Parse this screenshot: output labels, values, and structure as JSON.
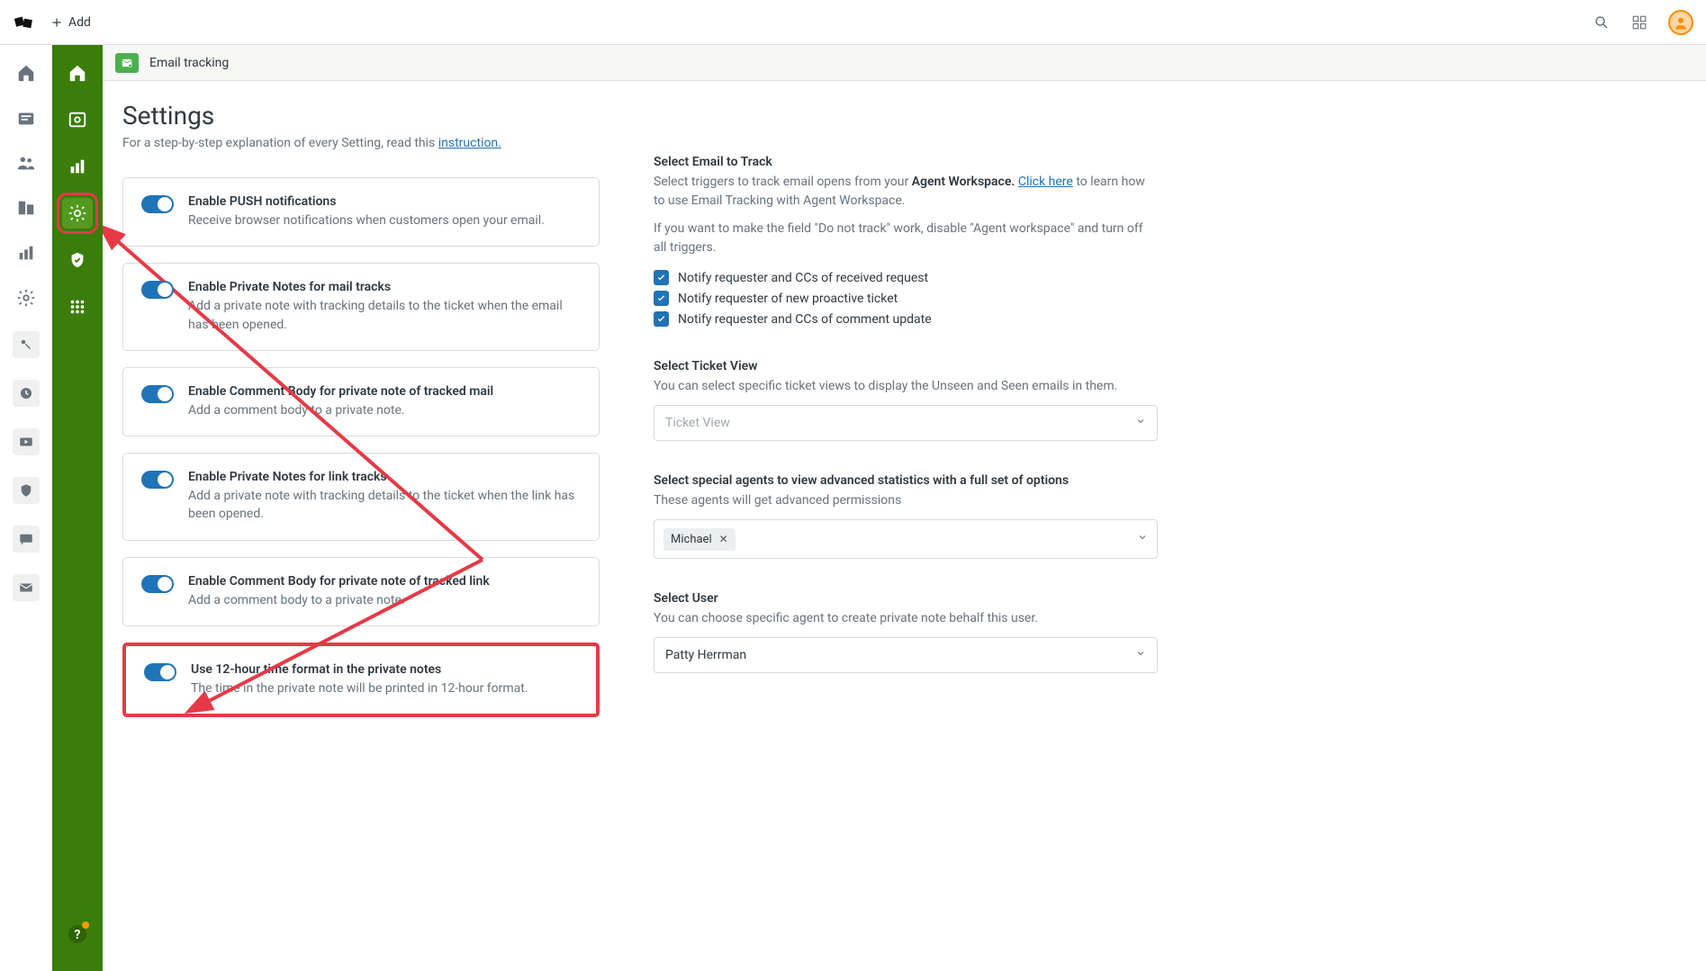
{
  "topbar": {
    "add_label": "Add"
  },
  "app_header": {
    "title": "Email tracking"
  },
  "page": {
    "title": "Settings",
    "subtitle_prefix": "For a step-by-step explanation of every Setting, read this ",
    "subtitle_link": "instruction."
  },
  "toggles": [
    {
      "title": "Enable PUSH notifications",
      "desc": "Receive browser notifications when customers open your email."
    },
    {
      "title": "Enable Private Notes for mail tracks",
      "desc": "Add a private note with tracking details to the ticket when the email has been opened."
    },
    {
      "title": "Enable Comment Body for private note of tracked mail",
      "desc": "Add a comment body to a private note."
    },
    {
      "title": "Enable Private Notes for link tracks",
      "desc": "Add a private note with tracking details to the ticket when the link has been opened."
    },
    {
      "title": "Enable Comment Body for private note of tracked link",
      "desc": "Add a comment body to a private note."
    },
    {
      "title": "Use 12-hour time format in the private notes",
      "desc": "The time in the private note will be printed in 12-hour format."
    }
  ],
  "track": {
    "title": "Select Email to Track",
    "line1_prefix": "Select triggers to track email opens from your ",
    "line1_bold": "Agent Workspace.",
    "line1_link": "Click here",
    "line1_suffix": " to learn how to use Email Tracking with Agent Workspace.",
    "line2": "If you want to make the field \"Do not track\" work, disable \"Agent workspace\" and turn off all triggers.",
    "checks": [
      "Notify requester and CCs of received request",
      "Notify requester of new proactive ticket",
      "Notify requester and CCs of comment update"
    ]
  },
  "ticketview": {
    "title": "Select Ticket View",
    "desc": "You can select specific ticket views to display the Unseen and Seen emails in them.",
    "placeholder": "Ticket View"
  },
  "agents": {
    "title": "Select special agents to view advanced statistics with a full set of options",
    "desc": "These agents will get advanced permissions",
    "chip": "Michael"
  },
  "user": {
    "title": "Select User",
    "desc": "You can choose specific agent to create private note behalf this user.",
    "value": "Patty Herrman"
  }
}
